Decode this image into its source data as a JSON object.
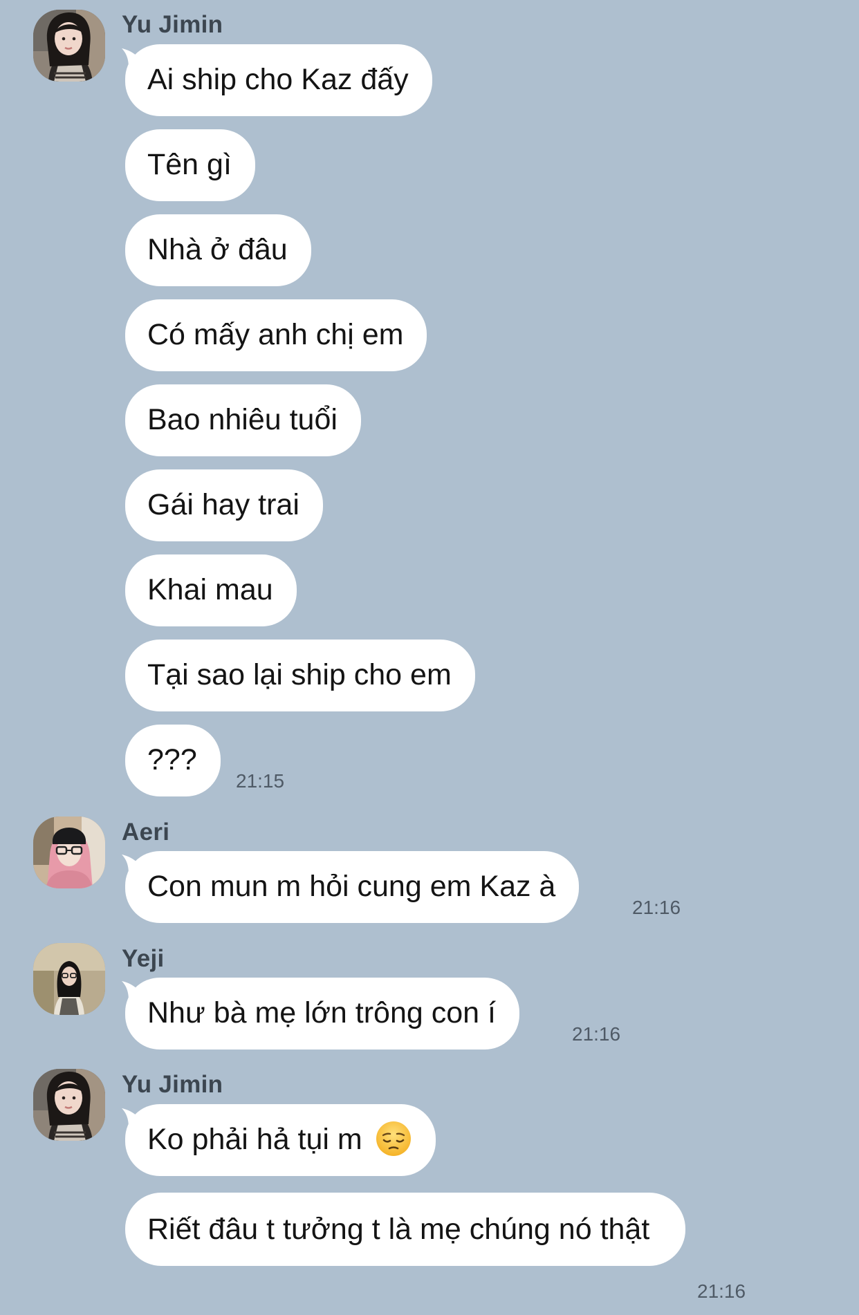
{
  "messages": [
    {
      "sender": "Yu Jimin",
      "lines": [
        "Ai ship cho Kaz đấy",
        "Tên gì",
        "Nhà ở đâu",
        "Có mấy anh chị em",
        "Bao nhiêu tuổi",
        "Gái hay trai",
        "Khai mau",
        "Tại sao lại ship cho em",
        "???"
      ],
      "time": "21:15"
    },
    {
      "sender": "Aeri",
      "text": "Con mun m hỏi cung em Kaz à",
      "time": "21:16"
    },
    {
      "sender": "Yeji",
      "text": "Như bà mẹ lớn trông con í",
      "time": "21:16"
    },
    {
      "sender": "Yu Jimin",
      "lines": [
        "Ko phải hả tụi m",
        "Riết đâu t tưởng t là mẹ chúng nó thật"
      ],
      "emoji": "pensive-face-emoji",
      "time": "21:16"
    }
  ],
  "colors": {
    "background": "#aebfcf",
    "bubble": "#ffffff",
    "text": "#141414",
    "sender": "#3c4650",
    "timestamp": "#4f5a66"
  }
}
